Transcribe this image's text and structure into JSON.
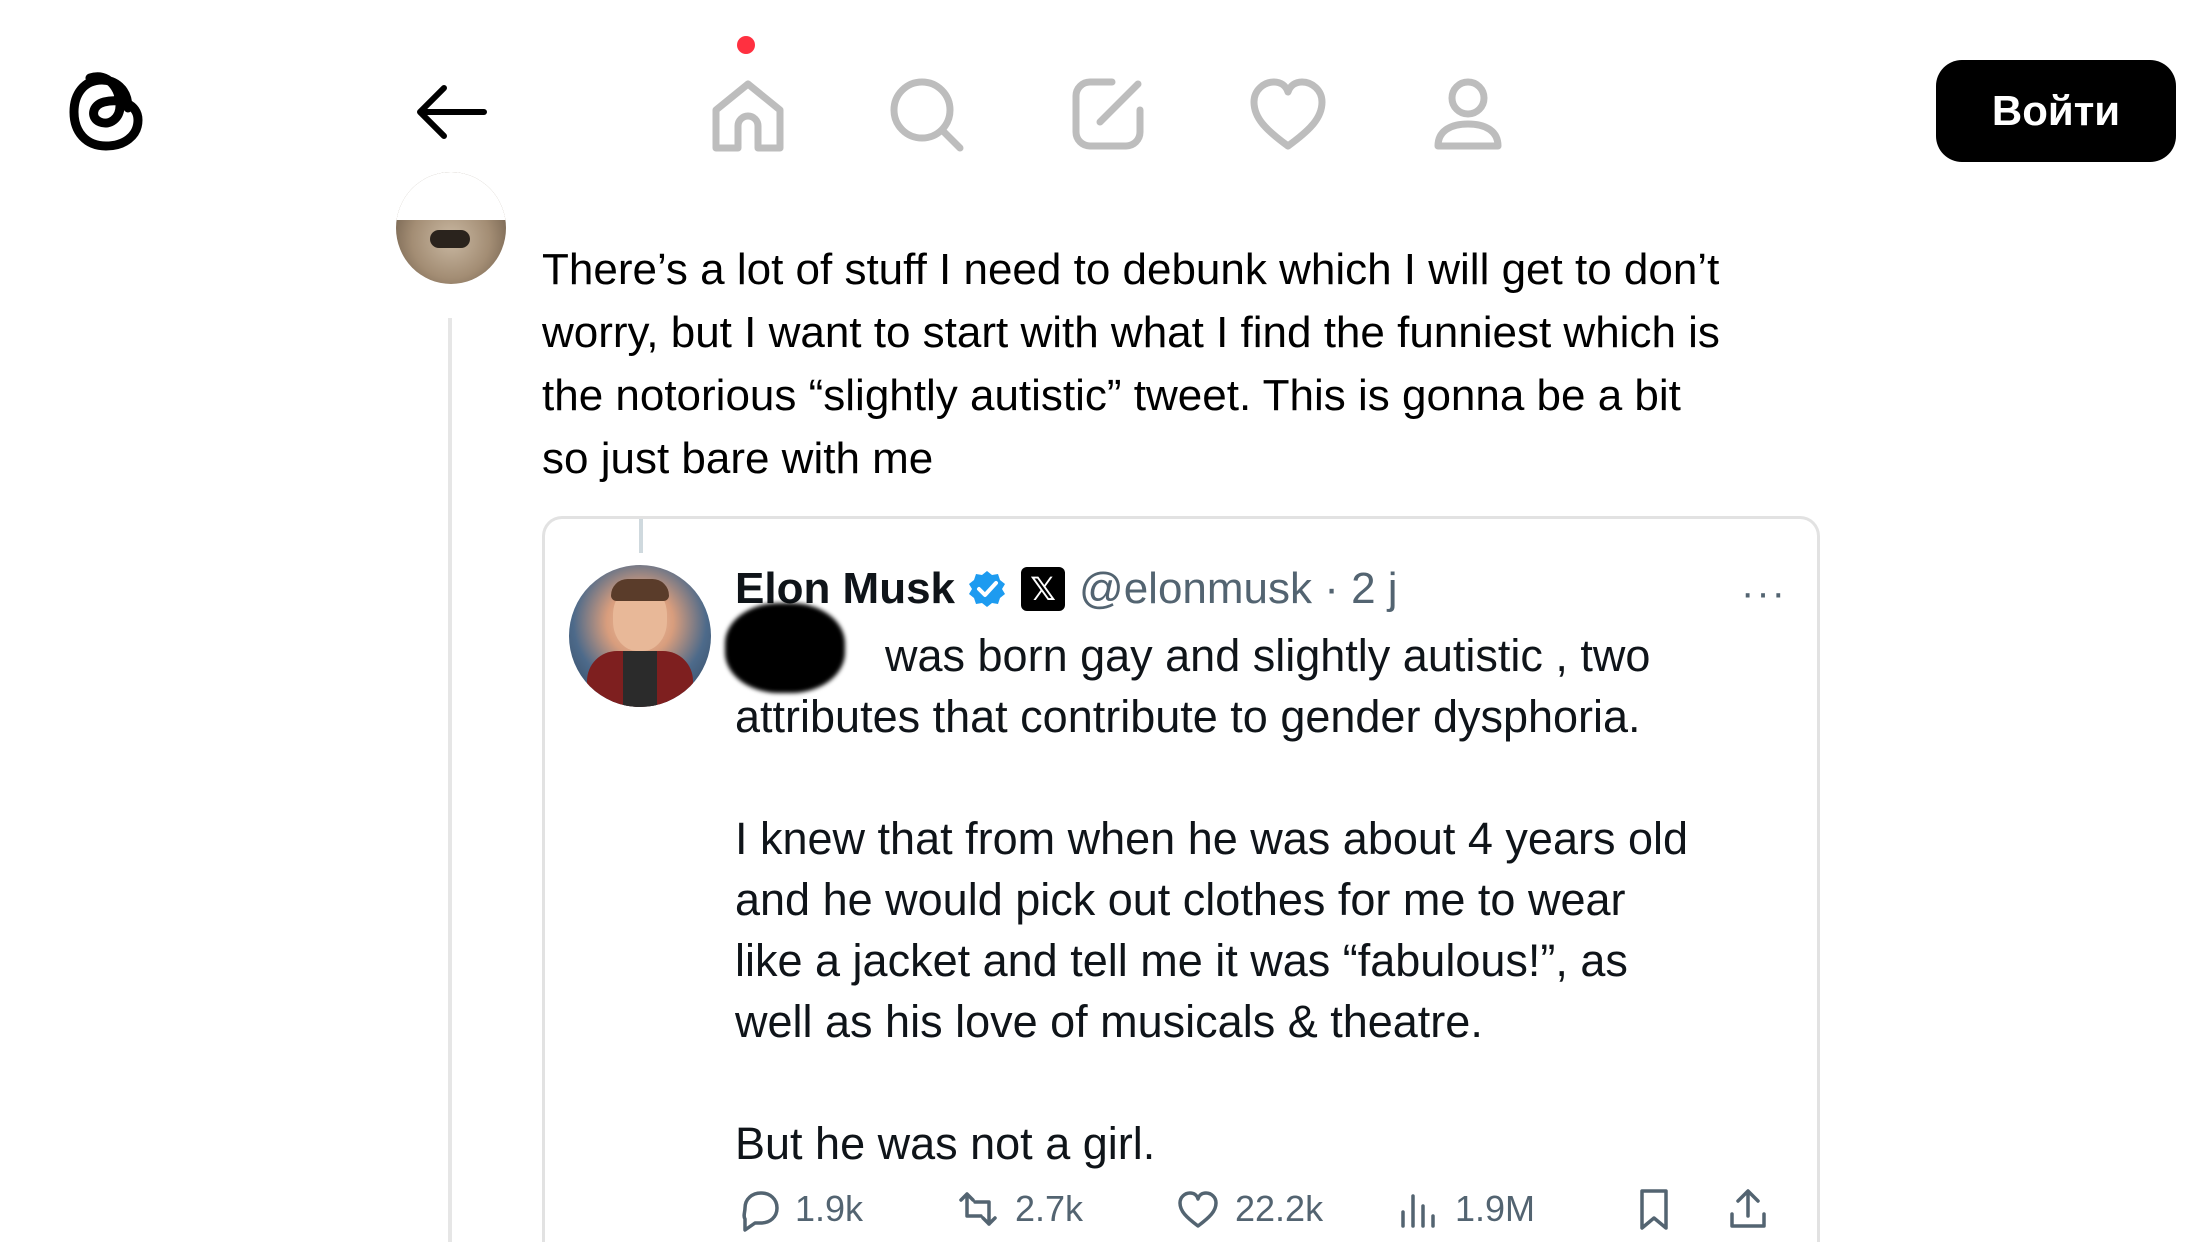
{
  "header": {
    "login_label": "Войти",
    "icons": [
      "threads-logo-icon",
      "back-arrow-icon",
      "home-icon",
      "search-icon",
      "compose-icon",
      "heart-icon",
      "profile-icon"
    ],
    "notification_dot_color": "#ff3040"
  },
  "post": {
    "text": "There’s a lot of stuff I need to debunk which I will get to don’t\nworry, but I want to start with what I find the funniest which is\nthe notorious “slightly autistic” tweet. This is gonna be a bit\nso just bare with me"
  },
  "embedded_tweet": {
    "author_name": "Elon Musk",
    "handle_time": "@elonmusk · 2 j",
    "more": "···",
    "text": "was born gay and slightly autistic , two\nattributes that contribute to gender dysphoria.\n\nI knew that from when he was about 4 years old\nand he would pick out clothes for me to wear\nlike a jacket and tell me it was “fabulous!”, as\nwell as his love of musicals & theatre.\n\nBut he was not a girl.",
    "stats": {
      "replies": "1.9k",
      "reposts": "2.7k",
      "likes": "22.2k",
      "views": "1.9M"
    },
    "colors": {
      "verified": "#1d9bf0",
      "secondary_text": "#536471"
    }
  }
}
